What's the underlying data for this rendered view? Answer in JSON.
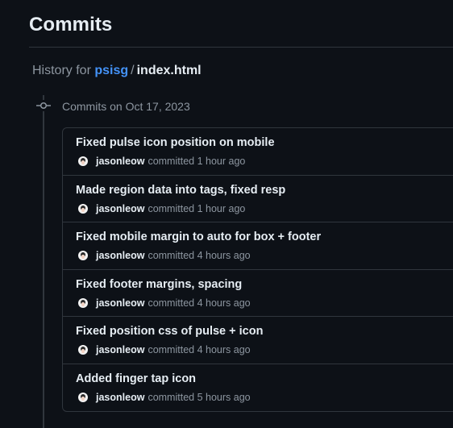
{
  "page": {
    "title": "Commits"
  },
  "history": {
    "prefix": "History for",
    "repo": "psisg",
    "separator": "/",
    "file": "index.html"
  },
  "timeline": {
    "date_heading": "Commits on Oct 17, 2023",
    "icon": "git-commit-icon"
  },
  "commits": [
    {
      "message": "Fixed pulse icon position on mobile",
      "author": "jasonleow",
      "verb": "committed",
      "time": "1 hour ago"
    },
    {
      "message": "Made region data into tags, fixed resp",
      "author": "jasonleow",
      "verb": "committed",
      "time": "1 hour ago"
    },
    {
      "message": "Fixed mobile margin to auto for box + footer",
      "author": "jasonleow",
      "verb": "committed",
      "time": "4 hours ago"
    },
    {
      "message": "Fixed footer margins, spacing",
      "author": "jasonleow",
      "verb": "committed",
      "time": "4 hours ago"
    },
    {
      "message": "Fixed position css of pulse + icon",
      "author": "jasonleow",
      "verb": "committed",
      "time": "4 hours ago"
    },
    {
      "message": "Added finger tap icon",
      "author": "jasonleow",
      "verb": "committed",
      "time": "5 hours ago"
    }
  ],
  "colors": {
    "background": "#0d1117",
    "border": "#30363d",
    "text": "#e6edf3",
    "muted": "#8d96a0",
    "link": "#4493f8"
  }
}
